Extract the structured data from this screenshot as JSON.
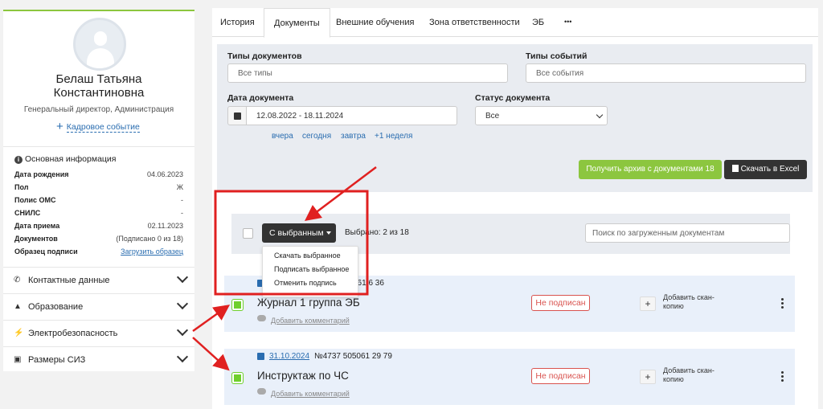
{
  "profile": {
    "name_line1": "Белаш Татьяна",
    "name_line2": "Константиновна",
    "position": "Генеральный директор, Администрация",
    "hr_event_label": "Кадровое событие"
  },
  "main_info": {
    "title": "Основная информация",
    "rows": [
      {
        "label": "Дата рождения",
        "value": "04.06.2023"
      },
      {
        "label": "Пол",
        "value": "Ж"
      },
      {
        "label": "Полис ОМС",
        "value": "-"
      },
      {
        "label": "СНИЛС",
        "value": "-"
      },
      {
        "label": "Дата приема",
        "value": "02.11.2023"
      },
      {
        "label": "Документов",
        "value": "(Подписано 0 из 18)"
      },
      {
        "label": "Образец подписи",
        "value": "Загрузить образец"
      }
    ]
  },
  "accordion": [
    {
      "label": "Контактные данные",
      "icon": "phone-icon"
    },
    {
      "label": "Образование",
      "icon": "graduation-cap-icon"
    },
    {
      "label": "Электробезопасность",
      "icon": "lightning-icon"
    },
    {
      "label": "Размеры СИЗ",
      "icon": "briefcase-icon"
    }
  ],
  "tabs": [
    "История",
    "Документы",
    "Внешние обучения",
    "Зона ответственности",
    "ЭБ",
    "•••"
  ],
  "filters": {
    "doc_types_label": "Типы документов",
    "doc_types_placeholder": "Все типы",
    "event_types_label": "Типы событий",
    "event_types_placeholder": "Все события",
    "doc_date_label": "Дата документа",
    "doc_date_value": "12.08.2022 - 18.11.2024",
    "quick_dates": [
      "вчера",
      "сегодня",
      "завтра",
      "+1 неделя"
    ],
    "doc_status_label": "Статус документа",
    "doc_status_value": "Все",
    "archive_button": "Получить архив с документами 18",
    "excel_button": "Скачать в Excel"
  },
  "actions": {
    "with_selected": "С выбранным",
    "selected_count": "Выбрано: 2 из 18",
    "search_placeholder": "Поиск по загруженным документам",
    "menu": [
      "Скачать выбранное",
      "Подписать выбранное",
      "Отменить подпись"
    ]
  },
  "documents": [
    {
      "date": "",
      "number": "061 6 36",
      "title": "Журнал 1 группа ЭБ",
      "status": "Не подписан",
      "scan_line1": "Добавить скан-",
      "scan_line2": "копию",
      "comment": "Добавить комментарий"
    },
    {
      "date": "31.10.2024",
      "number": "№4737 505061 29 79",
      "title": "Инструктаж по ЧС",
      "status": "Не подписан",
      "scan_line1": "Добавить скан-",
      "scan_line2": "копию",
      "comment": "Добавить комментарий"
    }
  ],
  "colors": {
    "accent_green": "#8cc63f",
    "link_blue": "#2a6db0",
    "annotation_red": "#e02020",
    "status_red": "#d9534f"
  }
}
